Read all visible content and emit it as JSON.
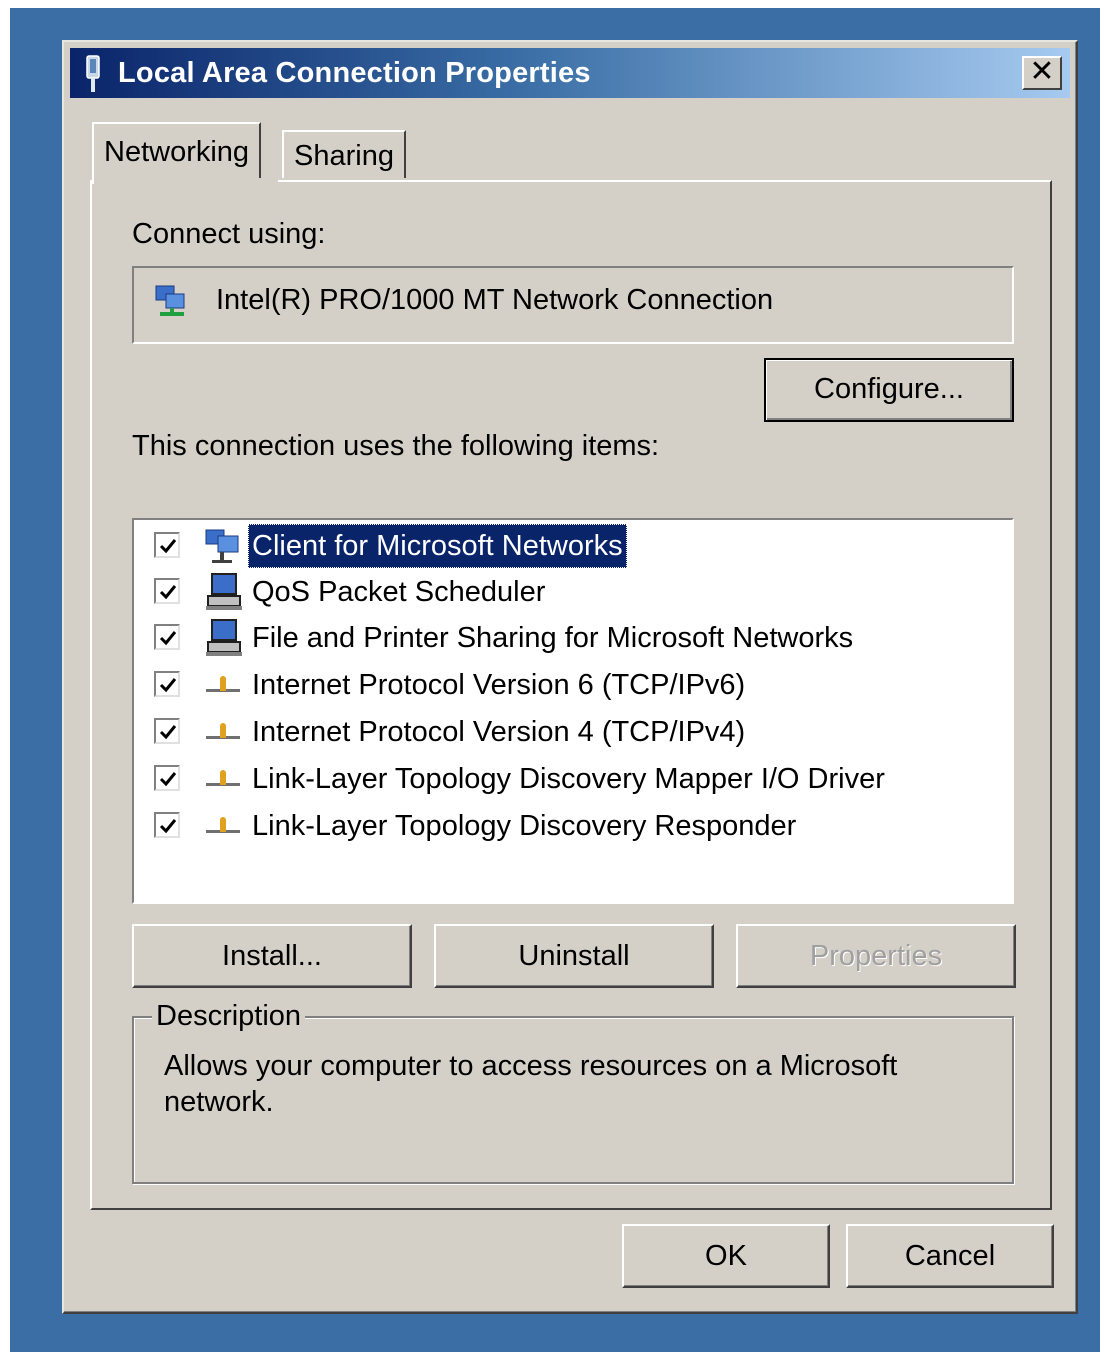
{
  "window": {
    "title": "Local Area Connection Properties",
    "close_glyph": "✕"
  },
  "tabs": [
    {
      "label": "Networking",
      "active": true
    },
    {
      "label": "Sharing",
      "active": false
    }
  ],
  "connect_using": {
    "label": "Connect using:",
    "adapter_name": "Intel(R) PRO/1000 MT Network Connection",
    "adapter_icon": "network-adapter-icon"
  },
  "buttons": {
    "configure": "Configure...",
    "install": "Install...",
    "uninstall": "Uninstall",
    "properties": "Properties",
    "ok": "OK",
    "cancel": "Cancel"
  },
  "items_label": "This connection uses the following items:",
  "items": [
    {
      "label": "Client for Microsoft Networks",
      "checked": true,
      "selected": true,
      "icon": "network-client-icon"
    },
    {
      "label": "QoS Packet Scheduler",
      "checked": true,
      "selected": false,
      "icon": "computer-service-icon"
    },
    {
      "label": "File and Printer Sharing for Microsoft Networks",
      "checked": true,
      "selected": false,
      "icon": "computer-service-icon"
    },
    {
      "label": "Internet Protocol Version 6 (TCP/IPv6)",
      "checked": true,
      "selected": false,
      "icon": "protocol-icon"
    },
    {
      "label": "Internet Protocol Version 4 (TCP/IPv4)",
      "checked": true,
      "selected": false,
      "icon": "protocol-icon"
    },
    {
      "label": "Link-Layer Topology Discovery Mapper I/O Driver",
      "checked": true,
      "selected": false,
      "icon": "protocol-icon"
    },
    {
      "label": "Link-Layer Topology Discovery Responder",
      "checked": true,
      "selected": false,
      "icon": "protocol-icon"
    }
  ],
  "description": {
    "legend": "Description",
    "text": "Allows your computer to access resources on a Microsoft network."
  },
  "colors": {
    "desktop": "#3a6ea5",
    "face": "#d4d0c8",
    "title_start": "#0a246a",
    "title_end": "#a6caf0",
    "selection": "#0a246a"
  }
}
